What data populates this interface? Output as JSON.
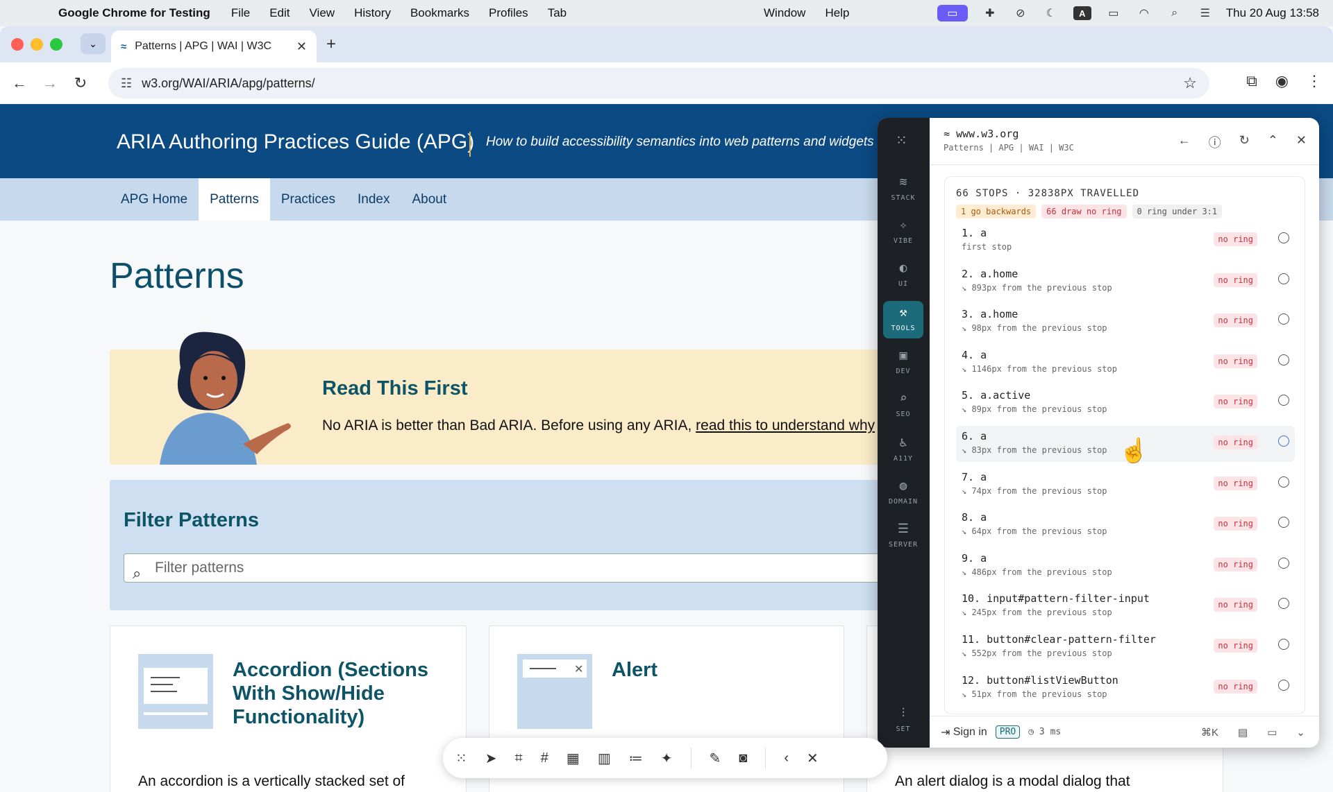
{
  "menubar": {
    "app_name": "Google Chrome for Testing",
    "menus": [
      "File",
      "Edit",
      "View",
      "History",
      "Bookmarks",
      "Profiles",
      "Tab"
    ],
    "window_menus": [
      "Window",
      "Help"
    ],
    "badge_a": "A",
    "datetime": "Thu 20 Aug  13:58"
  },
  "browser": {
    "tab_title": "Patterns | APG | WAI | W3C",
    "url": "w3.org/WAI/ARIA/apg/patterns/"
  },
  "site": {
    "title": "ARIA Authoring Practices Guide (APG)",
    "tagline": "How to build accessibility semantics into web patterns and widgets",
    "nav": [
      "APG Home",
      "Patterns",
      "Practices",
      "Index",
      "About"
    ],
    "heading": "Patterns",
    "rtf": {
      "heading": "Read This First",
      "text": "No ARIA is better than Bad ARIA. Before using any ARIA, ",
      "link": "read this to understand why"
    },
    "filter": {
      "heading": "Filter Patterns",
      "placeholder": "Filter patterns"
    },
    "cards": [
      {
        "title": "Accordion (Sections With Show/Hide Functionality)",
        "text": "An accordion is a vertically stacked set of"
      },
      {
        "title": "Alert",
        "text": ""
      },
      {
        "title": "",
        "text": "An alert dialog is a modal dialog that"
      }
    ]
  },
  "panel": {
    "rail": [
      "STACK",
      "VIBE",
      "UI",
      "TOOLS",
      "DEV",
      "SEO",
      "A11Y",
      "DOMAIN",
      "SERVER",
      "SET"
    ],
    "host": "www.w3.org",
    "subtitle": "Patterns | APG | WAI | W3C",
    "summary": "66 STOPS · 32838PX TRAVELLED",
    "chips": [
      "1 go backwards",
      "66 draw no ring",
      "0 ring under 3:1"
    ],
    "stops": [
      {
        "name": "1. a",
        "detail": "first stop",
        "ring": "no ring"
      },
      {
        "name": "2. a.home",
        "detail": "↘ 893px from the previous stop",
        "ring": "no ring"
      },
      {
        "name": "3. a.home",
        "detail": "↘ 98px from the previous stop",
        "ring": "no ring"
      },
      {
        "name": "4. a",
        "detail": "↘ 1146px from the previous stop",
        "ring": "no ring"
      },
      {
        "name": "5. a.active",
        "detail": "↘ 89px from the previous stop",
        "ring": "no ring"
      },
      {
        "name": "6. a",
        "detail": "↘ 83px from the previous stop",
        "ring": "no ring"
      },
      {
        "name": "7. a",
        "detail": "↘ 74px from the previous stop",
        "ring": "no ring"
      },
      {
        "name": "8. a",
        "detail": "↘ 64px from the previous stop",
        "ring": "no ring"
      },
      {
        "name": "9. a",
        "detail": "↘ 486px from the previous stop",
        "ring": "no ring"
      },
      {
        "name": "10. input#pattern-filter-input",
        "detail": "↘ 245px from the previous stop",
        "ring": "no ring"
      },
      {
        "name": "11. button#clear-pattern-filter",
        "detail": "↘ 552px from the previous stop",
        "ring": "no ring"
      },
      {
        "name": "12. button#listViewButton",
        "detail": "↘ 51px from the previous stop",
        "ring": "no ring"
      }
    ],
    "footer": {
      "sign_in": "Sign in",
      "pro": "PRO",
      "ms": "3 ms",
      "shortcut": "⌘K"
    }
  },
  "colors": {
    "hero": "#0b4a83",
    "nav": "#c7d9ec",
    "accent_teal": "#1c6b7a",
    "no_ring": "#c0323f"
  }
}
